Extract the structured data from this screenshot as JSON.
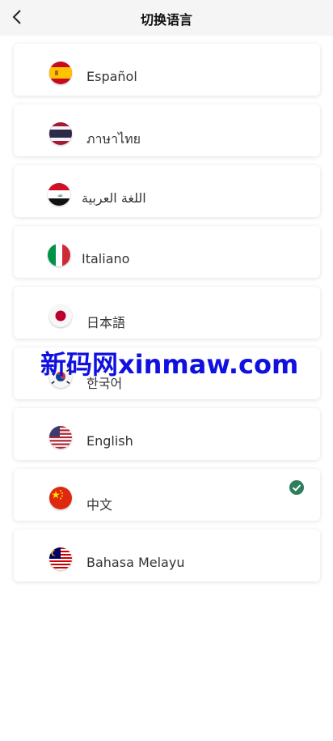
{
  "header": {
    "title": "切换语言",
    "back_icon": "chevron-left-icon"
  },
  "languages": [
    {
      "label": "Español",
      "flag": "spain-flag-icon",
      "selected": false
    },
    {
      "label": "ภาษาไทย",
      "flag": "thailand-flag-icon",
      "selected": false
    },
    {
      "label": "اللغة العربية",
      "flag": "iraq-flag-icon",
      "selected": false
    },
    {
      "label": "Italiano",
      "flag": "italy-flag-icon",
      "selected": false
    },
    {
      "label": "日本語",
      "flag": "japan-flag-icon",
      "selected": false
    },
    {
      "label": "한국어",
      "flag": "korea-flag-icon",
      "selected": false
    },
    {
      "label": "English",
      "flag": "usa-flag-icon",
      "selected": false
    },
    {
      "label": "中文",
      "flag": "china-flag-icon",
      "selected": true
    },
    {
      "label": "Bahasa Melayu",
      "flag": "malaysia-flag-icon",
      "selected": false
    }
  ],
  "watermark": "新码网xinmaw.com",
  "colors": {
    "check": "#2e7d5b",
    "header_bg": "#f5f5f5",
    "watermark": "#1010e0"
  }
}
